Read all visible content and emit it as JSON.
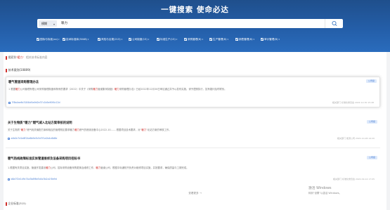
{
  "header": {
    "title": "一键搜索   使命必达",
    "search": {
      "scope": "模糊",
      "query": "暖力"
    },
    "filters": [
      "国标与标准(xx)",
      "技术标准库(3048)",
      "风险与合规(215)",
      "公司制度(15)",
      "标准生产(15)",
      "采购管理(6)",
      "生产管理(8)",
      "销售管理(6)",
      "审计管理(8)"
    ]
  },
  "results": {
    "hint_prefix": "搜索到",
    "hint_keyword": "\"暖力\"",
    "hint_suffix": "",
    "hint_tail": "相关技术标准内容",
    "section_label": "技术类别(10809)",
    "items": [
      {
        "title": "暖气管道采购管理办法",
        "tag": "公司级",
        "summary_parts": [
          {
            "text": "1 根据",
            "hl": false
          },
          {
            "text": "暖力",
            "hl": true
          },
          {
            "text": "公司管理有限公司采购管理制度和条例的要求（2022）中关于《采购",
            "hl": false
          },
          {
            "text": "暖力",
            "hl": true
          },
          {
            "text": "管道集采制度》",
            "hl": false
          },
          {
            "text": "暖力",
            "hl": true
          },
          {
            "text": "采购管理办法》已经2022年12月30日审议通过并予以发布实施。请予遵照执行，如有疑问及时联系。",
            "hl": false
          }
        ],
        "link": "7f8a4ae6c3184bf4a9d2e37c1b5a90f4c12d",
        "meta": "相关部门 标准化委员会   2022-12-30 15:48"
      },
      {
        "title": "关于生物质“暖力”燃气减入北站方案审核的说明",
        "tag": "公司级",
        "summary_parts": [
          {
            "text": "关于生物质“",
            "hl": false
          },
          {
            "text": "暖力",
            "hl": true
          },
          {
            "text": "”燃气相关输配方案和相应的管理规定要求暖力",
            "hl": false
          },
          {
            "text": "暖力",
            "hl": true
          },
          {
            "text": "燃气的燃烧设备中心2022-10-……根据项目技术要求，对“",
            "hl": false
          },
          {
            "text": "暖力",
            "hl": true
          },
          {
            "text": "”北站方案的审核工作。",
            "hl": false
          }
        ],
        "link": "a4b0c7d1e8f24a6b9e3c5d7f1a2b4c6d8e",
        "meta": "相关部门 能源公司   2022-10-26 14:20"
      },
      {
        "title": "暖气热线故障标准实体管道维修及设备采购项目招标书",
        "tag": "公司级",
        "summary_parts": [
          {
            "text": "1.根据有关项目实施，管道开发建设",
            "hl": false
          },
          {
            "text": "暖力",
            "hl": true
          },
          {
            "text": "公司，招标采购设备采购更换及维修工作，",
            "hl": false
          },
          {
            "text": "暖力",
            "hl": true
          },
          {
            "text": "管道公司，根据中标通知书负责对维修项目实施，并按要求，确保质量与工期完成。",
            "hl": false
          }
        ],
        "link": "b8a7f2e1d9c74a3b8f6e5d4c3b2a1f0e9d",
        "meta": "相关部门 标准化委员会   2022-09-14 17:05"
      }
    ],
    "more_label": "查看更多 →",
    "footer_section": "企业标准(315)"
  },
  "watermark": {
    "line1": "激活 Windows",
    "line2": "转到“设置”以激活 Windows。"
  },
  "colors": {
    "accent": "#2a6cbd",
    "highlight": "#d0312d",
    "tag_bg": "#dde9fb"
  }
}
